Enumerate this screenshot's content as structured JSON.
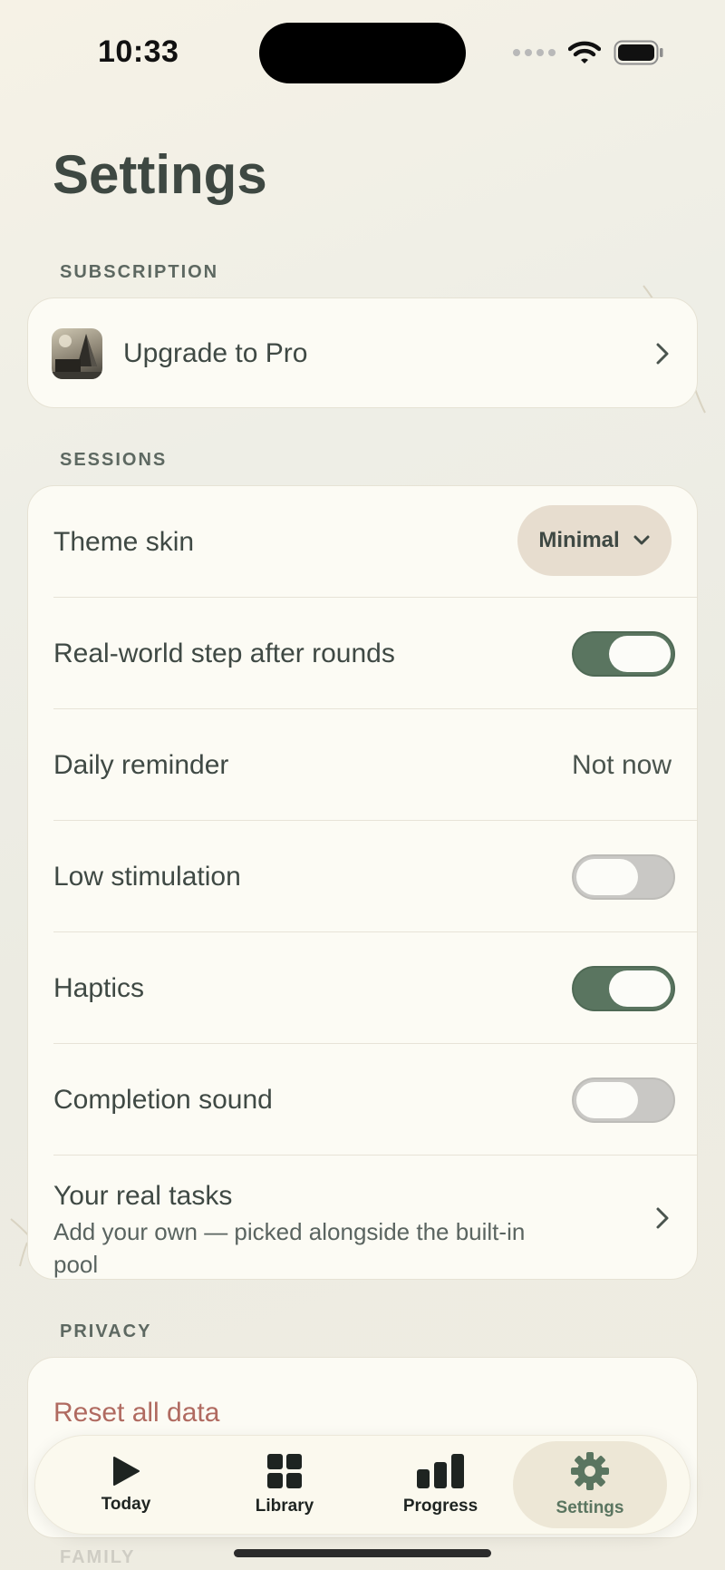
{
  "status_bar": {
    "time": "10:33"
  },
  "page": {
    "title": "Settings"
  },
  "sections": {
    "subscription": {
      "header": "SUBSCRIPTION",
      "upgrade": {
        "label": "Upgrade to Pro",
        "icon": "app-art-icon"
      }
    },
    "sessions": {
      "header": "SESSIONS",
      "theme_skin": {
        "label": "Theme skin",
        "value": "Minimal"
      },
      "real_world_step": {
        "label": "Real-world step after rounds",
        "enabled": true
      },
      "daily_reminder": {
        "label": "Daily reminder",
        "value": "Not now"
      },
      "low_stimulation": {
        "label": "Low stimulation",
        "enabled": false
      },
      "haptics": {
        "label": "Haptics",
        "enabled": true
      },
      "completion_sound": {
        "label": "Completion sound",
        "enabled": false
      },
      "real_tasks": {
        "title": "Your real tasks",
        "subtitle": "Add your own — picked alongside the built-in pool"
      }
    },
    "privacy": {
      "header": "PRIVACY",
      "reset": {
        "label": "Reset all data"
      }
    },
    "family": {
      "header": "FAMILY"
    }
  },
  "tab_bar": {
    "active": "settings",
    "tabs": [
      {
        "id": "today",
        "label": "Today",
        "icon": "play-icon"
      },
      {
        "id": "library",
        "label": "Library",
        "icon": "grid-icon"
      },
      {
        "id": "progress",
        "label": "Progress",
        "icon": "bar-chart-icon"
      },
      {
        "id": "settings",
        "label": "Settings",
        "icon": "gear-icon"
      }
    ]
  },
  "colors": {
    "accent_green": "#5a7560",
    "destructive": "#b06a60",
    "card_bg": "#fcfbf4",
    "pill_bg": "#e7ddcf",
    "toggle_off": "#c9c8c5"
  }
}
